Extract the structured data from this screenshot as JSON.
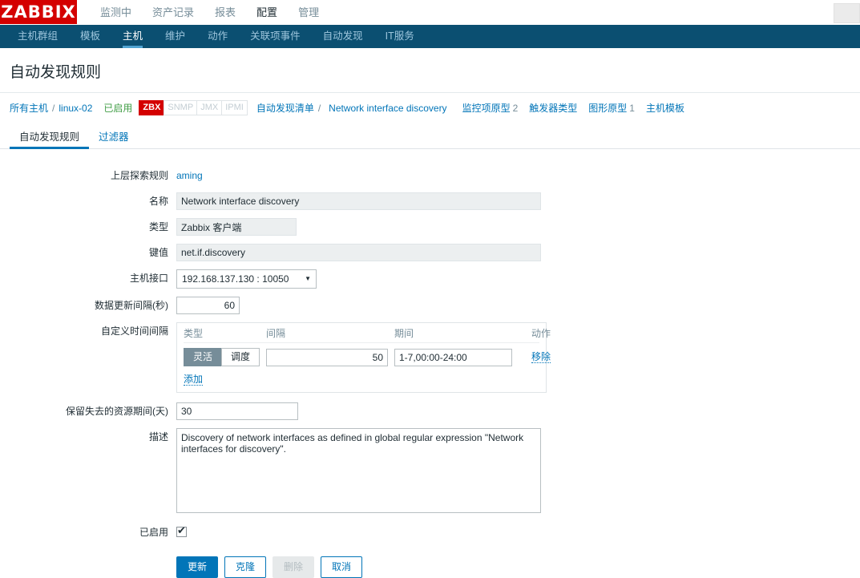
{
  "brand": {
    "logo": "ZABBIX"
  },
  "main_menu": {
    "items": [
      {
        "label": "监测中",
        "selected": false
      },
      {
        "label": "资产记录",
        "selected": false
      },
      {
        "label": "报表",
        "selected": false
      },
      {
        "label": "配置",
        "selected": true
      },
      {
        "label": "管理",
        "selected": false
      }
    ]
  },
  "sub_menu": {
    "items": [
      {
        "label": "主机群组",
        "selected": false
      },
      {
        "label": "模板",
        "selected": false
      },
      {
        "label": "主机",
        "selected": true
      },
      {
        "label": "维护",
        "selected": false
      },
      {
        "label": "动作",
        "selected": false
      },
      {
        "label": "关联项事件",
        "selected": false
      },
      {
        "label": "自动发现",
        "selected": false
      },
      {
        "label": "IT服务",
        "selected": false
      }
    ]
  },
  "page": {
    "title": "自动发现规则"
  },
  "breadcrumb": {
    "all_hosts": "所有主机",
    "separator": "/",
    "host": "linux-02",
    "status": "已启用",
    "badges": [
      {
        "label": "ZBX",
        "active": true
      },
      {
        "label": "SNMP",
        "active": false
      },
      {
        "label": "JMX",
        "active": false
      },
      {
        "label": "IPMI",
        "active": false
      }
    ],
    "discovery_list": "自动发现清单",
    "current": "Network interface discovery",
    "item_prototypes": "监控项原型",
    "item_prototypes_count": "2",
    "trigger_prototypes": "触发器类型",
    "graph_prototypes": "图形原型",
    "graph_prototypes_count": "1",
    "host_prototypes": "主机模板"
  },
  "tabs": [
    {
      "label": "自动发现规则",
      "selected": true
    },
    {
      "label": "过滤器",
      "selected": false
    }
  ],
  "form": {
    "parent_rule": {
      "label": "上层探索规则",
      "value": "aming"
    },
    "name": {
      "label": "名称",
      "value": "Network interface discovery"
    },
    "type": {
      "label": "类型",
      "value": "Zabbix 客户端"
    },
    "key": {
      "label": "键值",
      "value": "net.if.discovery"
    },
    "host_interface": {
      "label": "主机接口",
      "value": "192.168.137.130 : 10050",
      "caret": "▼"
    },
    "update_interval": {
      "label": "数据更新间隔(秒)",
      "value": "60"
    },
    "custom_intervals": {
      "label": "自定义时间间隔",
      "headers": {
        "type": "类型",
        "interval": "间隔",
        "period": "期间",
        "action": "动作"
      },
      "rows": [
        {
          "type_flexible": "灵活",
          "type_scheduling": "调度",
          "type_selected": "灵活",
          "interval": "50",
          "period": "1-7,00:00-24:00",
          "remove": "移除"
        }
      ],
      "add": "添加"
    },
    "lifetime": {
      "label": "保留失去的资源期间(天)",
      "value": "30"
    },
    "description": {
      "label": "描述",
      "value": "Discovery of network interfaces as defined in global regular expression \"Network interfaces for discovery\"."
    },
    "enabled": {
      "label": "已启用",
      "checked": true
    }
  },
  "buttons": {
    "update": "更新",
    "clone": "克隆",
    "delete": "删除",
    "cancel": "取消"
  },
  "colors": {
    "brand_red": "#d40000",
    "subnav_blue": "#0b4f71",
    "link_blue": "#0275b8",
    "enabled_green": "#429e47",
    "radio_on_gray": "#768d99"
  }
}
